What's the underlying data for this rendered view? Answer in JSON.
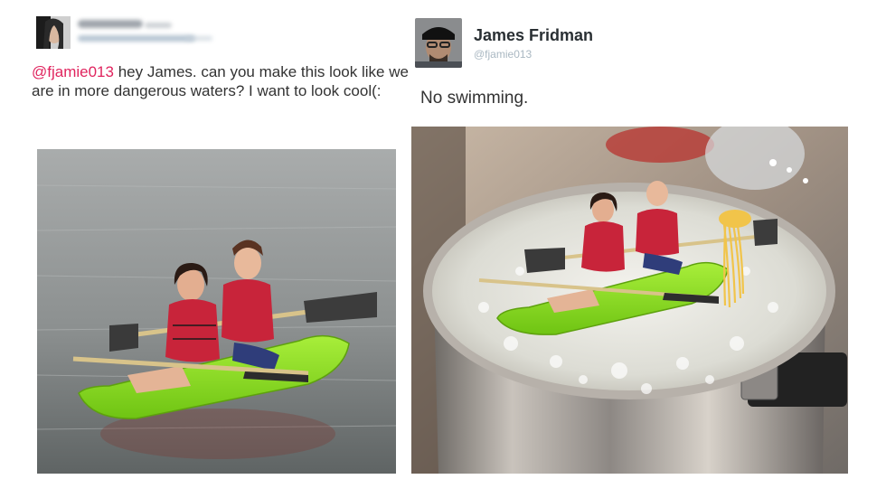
{
  "original_tweet": {
    "mention": "@fjamie013",
    "text": " hey James. can you make this look like we are in more dangerous waters? I want to look cool(:"
  },
  "reply_tweet": {
    "display_name": "James Fridman",
    "handle": "@fjamie013",
    "text": "No swimming."
  },
  "colors": {
    "mention": "#e0245e",
    "kayak": "#8ee01f",
    "lifejacket": "#c8243a"
  }
}
